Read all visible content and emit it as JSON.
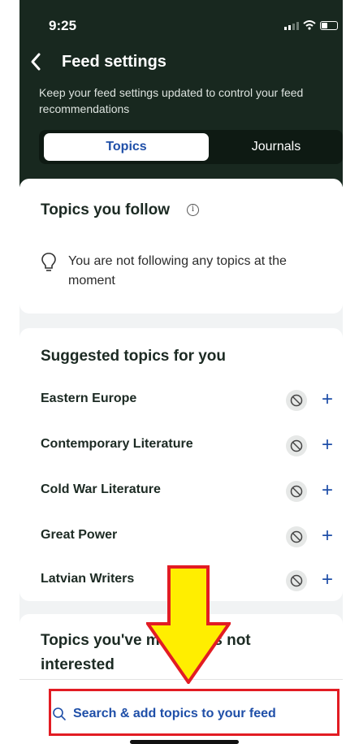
{
  "status_bar": {
    "time": "9:25"
  },
  "header": {
    "title": "Feed settings",
    "subtitle": "Keep your feed settings updated to control your feed recommendations"
  },
  "tabs": [
    {
      "label": "Topics",
      "active": true
    },
    {
      "label": "Journals",
      "active": false
    }
  ],
  "following": {
    "heading": "Topics you follow",
    "empty_message": "You are not following any topics at the moment"
  },
  "suggested": {
    "heading": "Suggested topics for you",
    "items": [
      {
        "label": "Eastern Europe"
      },
      {
        "label": "Contemporary Literature"
      },
      {
        "label": "Cold War Literature"
      },
      {
        "label": "Great Power"
      },
      {
        "label": "Latvian Writers"
      }
    ]
  },
  "not_interested": {
    "heading": "Topics you've marked as not interested"
  },
  "footer": {
    "search_label": "Search & add topics to your feed"
  },
  "colors": {
    "header_bg": "#18281f",
    "accent": "#1f4fa8",
    "annotation_red": "#e21c23",
    "annotation_yellow": "#ffee00"
  },
  "icons": {
    "back": "chevron-left-icon",
    "info": "info-icon",
    "empty": "lightbulb-icon",
    "block": "block-icon",
    "add": "plus-icon",
    "search": "search-icon"
  }
}
